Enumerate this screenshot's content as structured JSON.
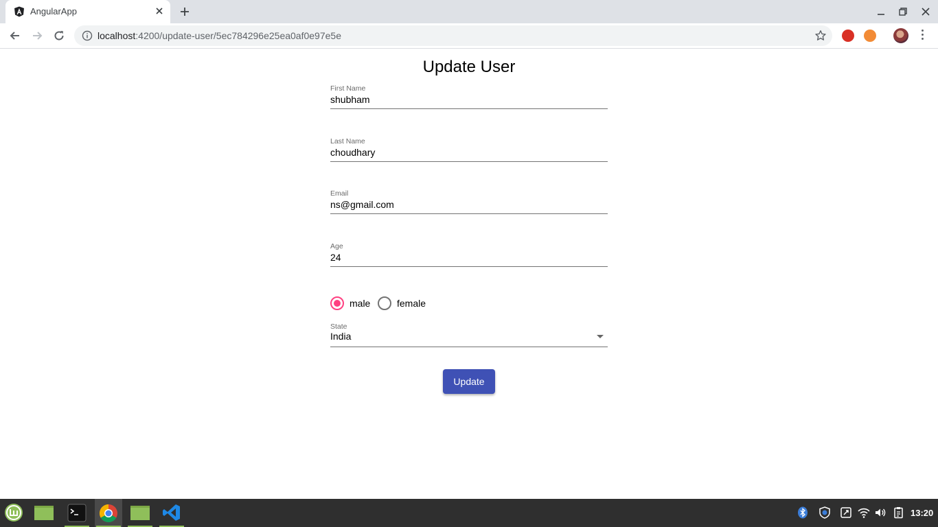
{
  "browser": {
    "tab_title": "AngularApp",
    "url_host": "localhost",
    "url_path": ":4200/update-user/5ec784296e25ea0af0e97e5e"
  },
  "form": {
    "title": "Update User",
    "fields": [
      {
        "label": "First Name",
        "value": "shubham"
      },
      {
        "label": "Last Name",
        "value": "choudhary"
      },
      {
        "label": "Email",
        "value": "ns@gmail.com"
      },
      {
        "label": "Age",
        "value": "24"
      }
    ],
    "gender": {
      "options": [
        {
          "label": "male",
          "checked": true
        },
        {
          "label": "female",
          "checked": false
        }
      ]
    },
    "state": {
      "label": "State",
      "value": "India"
    },
    "submit_label": "Update"
  },
  "theme": {
    "primary": "#3f51b5",
    "accent": "#ff4081"
  },
  "taskbar": {
    "clock": "13:20"
  }
}
